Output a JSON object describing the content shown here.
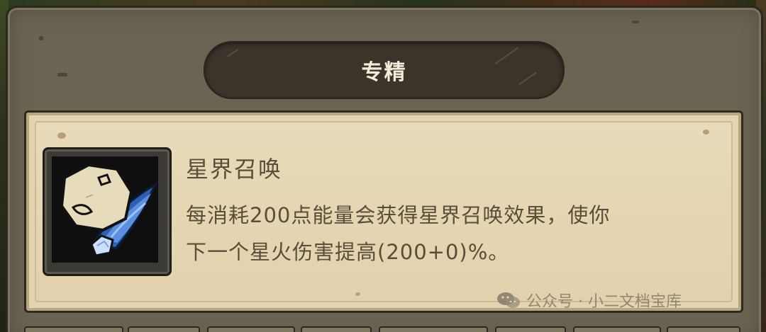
{
  "dialog": {
    "title": "专精"
  },
  "skill": {
    "icon": "astral-summon-icon",
    "name": "星界召唤",
    "description_lines": [
      "每消耗200点能量会获得星界召唤效果，使你",
      "下一个星火伤害提高(200+0)%。"
    ]
  },
  "watermark": {
    "icon": "wechat-icon",
    "text": "公众号 · 小二文档宝库"
  },
  "colors": {
    "panel": "#6a6452",
    "title_pill": "#3a342a",
    "parchment": "#e4d4b0",
    "text_brown": "#5a4d3a",
    "title_text": "#f3ecd9"
  }
}
